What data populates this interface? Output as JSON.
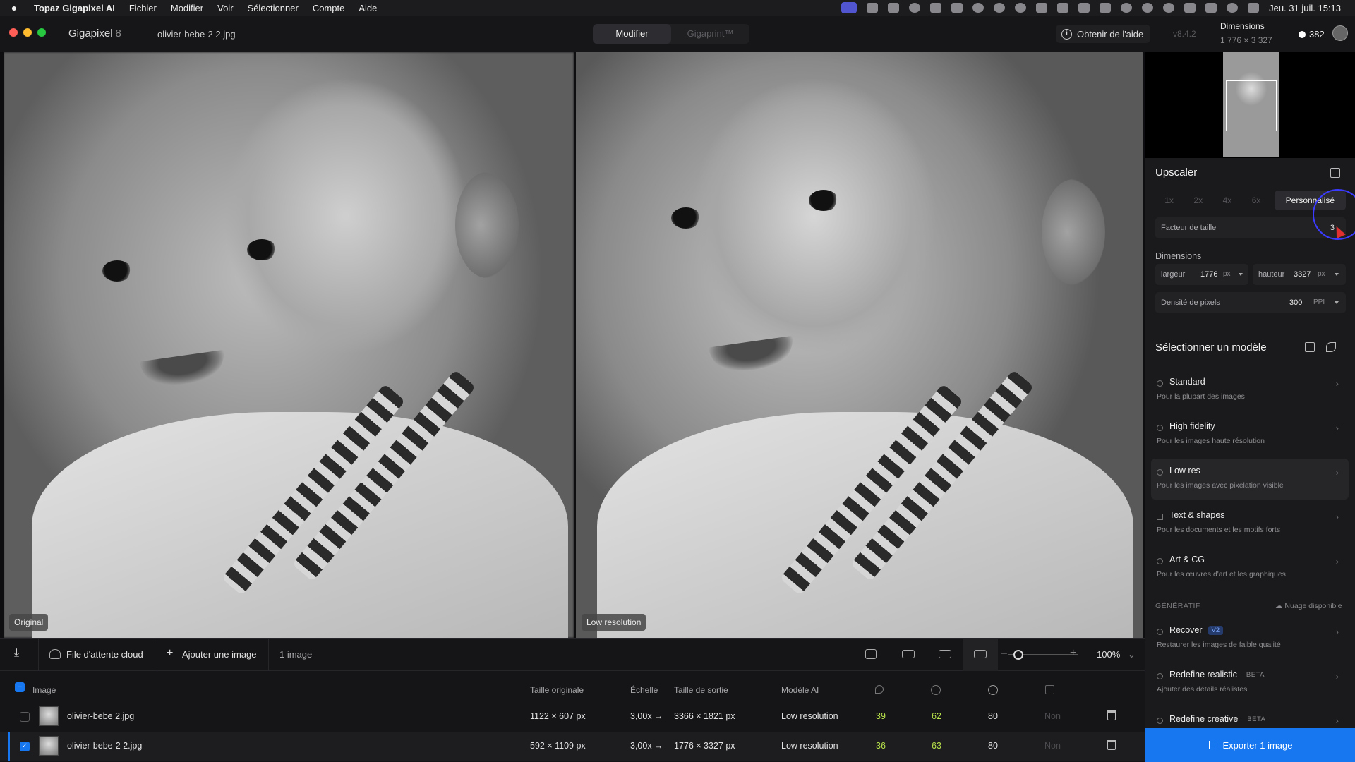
{
  "menubar": {
    "app": "Topaz Gigapixel AI",
    "items": [
      "Fichier",
      "Modifier",
      "Voir",
      "Sélectionner",
      "Compte",
      "Aide"
    ],
    "clock": "Jeu. 31 juil.  15:13"
  },
  "titlebar": {
    "app_name": "Gigapixel",
    "app_version": "8",
    "file_name": "olivier-bebe-2 2.jpg",
    "tabs": [
      "Modifier",
      "Gigaprint™"
    ],
    "help": "Obtenir de l'aide",
    "version": "v8.4.2",
    "dims_label": "Dimensions",
    "dims_value": "1 776 × 3 327",
    "credits": "382"
  },
  "panes": {
    "left_label": "Original",
    "right_label": "Low resolution"
  },
  "sidebar": {
    "upscaler_title": "Upscaler",
    "scale_options": [
      "1x",
      "2x",
      "4x",
      "6x"
    ],
    "scale_custom": "Personnalisé",
    "size_factor_label": "Facteur de taille",
    "size_factor_value": "3",
    "dimensions_title": "Dimensions",
    "width_label": "largeur",
    "width_value": "1776",
    "height_label": "hauteur",
    "height_value": "3327",
    "unit_px": "px",
    "density_label": "Densité de pixels",
    "density_value": "300",
    "density_unit": "PPI",
    "model_title": "Sélectionner un modèle",
    "models": [
      {
        "name": "Standard",
        "desc": "Pour la plupart des images"
      },
      {
        "name": "High fidelity",
        "desc": "Pour les images haute résolution"
      },
      {
        "name": "Low res",
        "desc": "Pour les images avec pixelation visible"
      },
      {
        "name": "Text & shapes",
        "desc": "Pour les documents et les motifs forts"
      },
      {
        "name": "Art & CG",
        "desc": "Pour les œuvres d'art et les graphiques"
      }
    ],
    "generative_label": "GÉNÉRATIF",
    "cloud_label": "Nuage disponible",
    "gen_models": [
      {
        "name": "Recover",
        "badge": "V2",
        "desc": "Restaurer les images de faible qualité"
      },
      {
        "name": "Redefine realistic",
        "badge": "BETA",
        "desc": "Ajouter des détails réalistes"
      },
      {
        "name": "Redefine creative",
        "badge": "BETA",
        "desc": ""
      }
    ],
    "export": "Exporter 1 image"
  },
  "toolbar": {
    "cloud_queue": "File d'attente cloud",
    "add_image": "Ajouter une image",
    "count": "1 image",
    "zoom": "100%"
  },
  "table": {
    "headers": {
      "image": "Image",
      "orig_size": "Taille originale",
      "scale": "Échelle",
      "out_size": "Taille de sortie",
      "model": "Modèle AI"
    },
    "rows": [
      {
        "name": "olivier-bebe 2.jpg",
        "orig": "1122 × 607 px",
        "scale": "3,00x →",
        "out": "3366 × 1821 px",
        "model": "Low resolution",
        "v1": "39",
        "v2": "62",
        "v3": "80",
        "v4": "Non"
      },
      {
        "name": "olivier-bebe-2 2.jpg",
        "orig": "592 × 1109 px",
        "scale": "3,00x →",
        "out": "1776 × 3327 px",
        "model": "Low resolution",
        "v1": "36",
        "v2": "63",
        "v3": "80",
        "v4": "Non"
      }
    ]
  }
}
